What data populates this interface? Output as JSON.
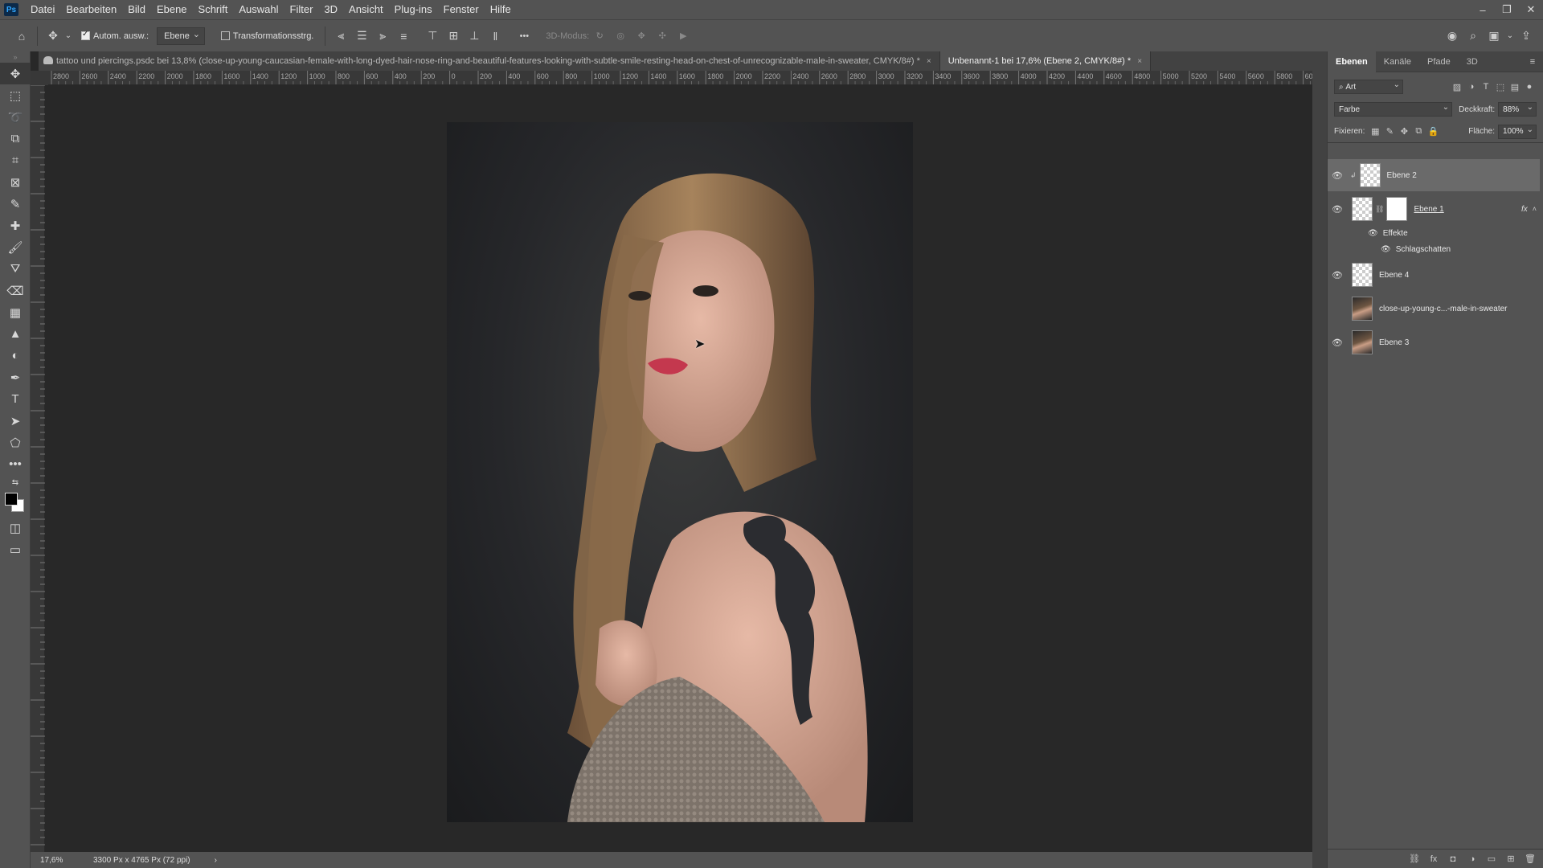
{
  "app": {
    "logo": "Ps"
  },
  "menu": [
    "Datei",
    "Bearbeiten",
    "Bild",
    "Ebene",
    "Schrift",
    "Auswahl",
    "Filter",
    "3D",
    "Ansicht",
    "Plug-ins",
    "Fenster",
    "Hilfe"
  ],
  "window_controls": {
    "minimize": "–",
    "restore": "❐",
    "close": "✕"
  },
  "options": {
    "auto_select_label": "Autom. ausw.:",
    "auto_select_checked": true,
    "auto_select_value": "Ebene",
    "transform_label": "Transformationsstrg.",
    "transform_checked": false,
    "mode_3d_label": "3D-Modus:",
    "more": "•••"
  },
  "tabs": [
    {
      "title": "tattoo und piercings.psdc bei 13,8% (close-up-young-caucasian-female-with-long-dyed-hair-nose-ring-and-beautiful-features-looking-with-subtle-smile-resting-head-on-chest-of-unrecognizable-male-in-sweater, CMYK/8#) *",
      "close": "×",
      "active": false
    },
    {
      "title": "Unbenannt-1 bei 17,6% (Ebene 2, CMYK/8#) *",
      "close": "×",
      "active": true
    }
  ],
  "ruler_h_labels": [
    "2800",
    "2600",
    "2400",
    "2200",
    "2000",
    "1800",
    "1600",
    "1400",
    "1200",
    "1000",
    "800",
    "600",
    "400",
    "200",
    "0",
    "200",
    "400",
    "600",
    "800",
    "1000",
    "1200",
    "1400",
    "1600",
    "1800",
    "2000",
    "2200",
    "2400",
    "2600",
    "2800",
    "3000",
    "3200",
    "3400",
    "3600",
    "3800",
    "4000",
    "4200",
    "4400",
    "4600",
    "4800",
    "5000",
    "5200",
    "5400",
    "5600",
    "5800",
    "6000"
  ],
  "status": {
    "zoom": "17,6%",
    "doc_info": "3300 Px x 4765 Px (72 ppi)",
    "arrow": "›"
  },
  "layers_panel": {
    "tabs": [
      "Ebenen",
      "Kanäle",
      "Pfade",
      "3D"
    ],
    "filter_label": "Art",
    "blend_mode": "Farbe",
    "opacity_label": "Deckkraft:",
    "opacity_value": "88%",
    "lock_label": "Fixieren:",
    "fill_label": "Fläche:",
    "fill_value": "100%",
    "layers": [
      {
        "name": "Ebene 2",
        "visible": true,
        "selected": true
      },
      {
        "name": "Ebene 1",
        "visible": true,
        "fx": "fx"
      },
      {
        "name": "Ebene 4",
        "visible": true
      },
      {
        "name": "close-up-young-c...-male-in-sweater",
        "visible": false
      },
      {
        "name": "Ebene 3",
        "visible": true
      }
    ],
    "effects_label": "Effekte",
    "effect_item": "Schlagschatten"
  },
  "colors": {
    "ui_dark": "#535353",
    "canvas_bg": "#282828",
    "selected_layer": "#6a6a6a"
  }
}
